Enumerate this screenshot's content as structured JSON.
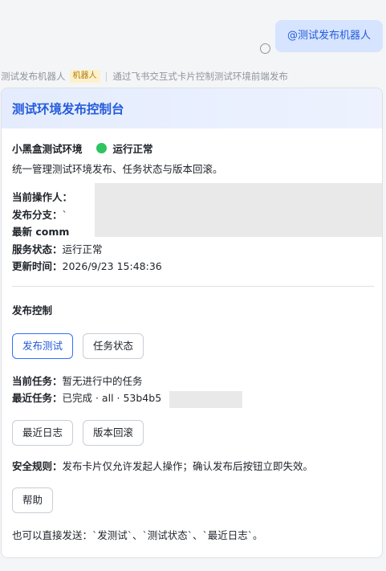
{
  "user_message": {
    "text": "@测试发布机器人"
  },
  "sender": {
    "name": "测试发布机器人",
    "tag": "机器人",
    "separator": "|",
    "summary": "通过飞书交互式卡片控制测试环境前端发布"
  },
  "card": {
    "title": "测试环境发布控制台",
    "env_name": "小黑盒测试环境",
    "env_status": "运行正常",
    "description": "统一管理测试环境发布、任务状态与版本回滚。",
    "info": [
      {
        "label": "当前操作人：",
        "value": ""
      },
      {
        "label": "发布分支：",
        "value": "`"
      },
      {
        "label": "最新 comm",
        "value": ""
      },
      {
        "label": "服务状态：",
        "value": "运行正常"
      },
      {
        "label": "更新时间：",
        "value": "2026/9/23 15:48:36"
      }
    ],
    "control_title": "发布控制",
    "buttons_primary": {
      "publish": "发布测试",
      "status": "任务状态"
    },
    "current_task": {
      "label": "当前任务：",
      "value": "暂无进行中的任务"
    },
    "recent_task": {
      "label": "最近任务：",
      "value": "已完成 · all · 53b4b5"
    },
    "buttons_secondary": {
      "log": "最近日志",
      "rollback": "版本回滚"
    },
    "safety": {
      "label": "安全规则：",
      "value": "发布卡片仅允许发起人操作；确认发布后按钮立即失效。"
    },
    "help_label": "帮助",
    "footer": "也可以直接发送：`发测试`、`测试状态`、`最近日志`。"
  },
  "colors": {
    "accent": "#245bdb",
    "status_green": "#2ec45f",
    "bubble": "#d6e4ff"
  }
}
